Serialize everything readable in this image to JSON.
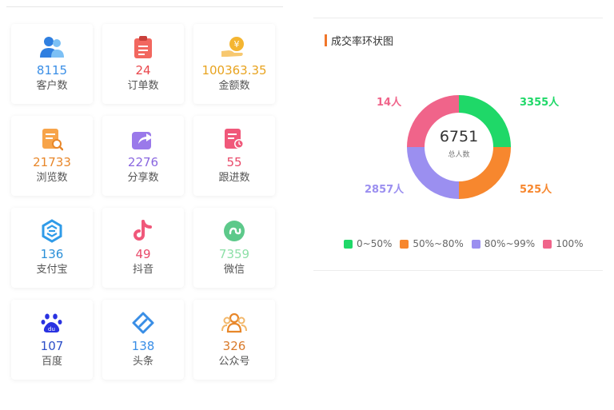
{
  "stats": [
    {
      "value": "8115",
      "label": "客户数",
      "color": "#3a8ee6",
      "icon": "customers-icon"
    },
    {
      "value": "24",
      "label": "订单数",
      "color": "#e9474c",
      "icon": "order-clipboard-icon"
    },
    {
      "value": "100363.35",
      "label": "金额数",
      "color": "#e8a31f",
      "icon": "money-hand-icon"
    },
    {
      "value": "21733",
      "label": "浏览数",
      "color": "#e8872a",
      "icon": "browse-document-icon"
    },
    {
      "value": "2276",
      "label": "分享数",
      "color": "#8a67e0",
      "icon": "share-icon"
    },
    {
      "value": "55",
      "label": "跟进数",
      "color": "#e94a6a",
      "icon": "follow-up-icon"
    },
    {
      "value": "136",
      "label": "支付宝",
      "color": "#2a8fd8",
      "icon": "alipay-icon"
    },
    {
      "value": "49",
      "label": "抖音",
      "color": "#e94a6a",
      "icon": "douyin-icon"
    },
    {
      "value": "7359",
      "label": "微信",
      "color": "#8ee0a8",
      "icon": "wechat-miniprogram-icon"
    },
    {
      "value": "107",
      "label": "百度",
      "color": "#2c4fc8",
      "icon": "baidu-icon"
    },
    {
      "value": "138",
      "label": "头条",
      "color": "#3a8ee6",
      "icon": "toutiao-link-icon"
    },
    {
      "value": "326",
      "label": "公众号",
      "color": "#d97a2a",
      "icon": "official-account-icon"
    }
  ],
  "ring": {
    "title": "成交率环状图",
    "total_value": "6751",
    "total_label": "总人数",
    "segments": [
      {
        "label": "0~50%",
        "count_text": "3355人",
        "share": 0.25,
        "color": "#1fd868"
      },
      {
        "label": "50%~80%",
        "count_text": "525人",
        "share": 0.25,
        "color": "#f7872e"
      },
      {
        "label": "80%~99%",
        "count_text": "2857人",
        "share": 0.25,
        "color": "#9b8ff0"
      },
      {
        "label": "100%",
        "count_text": "14人",
        "share": 0.25,
        "color": "#f0648a"
      }
    ]
  }
}
